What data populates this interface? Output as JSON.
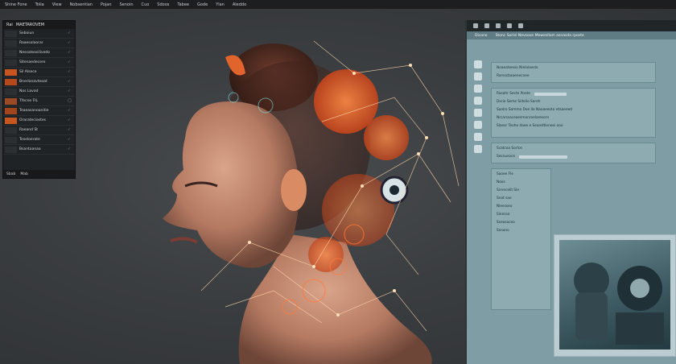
{
  "menubar": [
    "Shine Fone",
    "Tolia",
    "View",
    "Nobsentian",
    "Pojan",
    "Senoin",
    "Cuo",
    "Sdoos",
    "Tabee",
    "Gode",
    "Ylan",
    "Aleddo"
  ],
  "layers": {
    "header": [
      "Rai",
      "MAETAROVEM"
    ],
    "rows": [
      {
        "label": "Seboiun",
        "vis": "✓"
      },
      {
        "label": "Raaesolaorar",
        "vis": "✓"
      },
      {
        "label": "Nessateasilivedo",
        "vis": "✓"
      },
      {
        "label": "Sitenaedecere",
        "vis": "✓"
      },
      {
        "label": "Sil Alsece",
        "vis": "✓"
      },
      {
        "label": "Bnerlanavteoat",
        "vis": "✓"
      },
      {
        "label": "Nos Lavad",
        "vis": "✓"
      },
      {
        "label": "Tfecne FIL",
        "vis": "◯"
      },
      {
        "label": "Teaeasanoanitie",
        "vis": "✓"
      },
      {
        "label": "Orarateciastes",
        "vis": "✓"
      },
      {
        "label": "Raeand St",
        "vis": "✓"
      },
      {
        "label": "Teseloerate",
        "vis": "✓"
      },
      {
        "label": "Bsantaanaa",
        "vis": "✓"
      }
    ],
    "footer": [
      "Sbab",
      "Mab"
    ]
  },
  "right_panel": {
    "tabs": [
      "Dicono",
      "Stonc Sorlei Nevsoon Mewesllom asnasda rposte"
    ],
    "sections": [
      [
        "Noaeateesio Nlelalaeslo",
        "Rarsscbaaenecnee"
      ],
      [
        "Rasahr  Sectn Ponte",
        "Dxrie Seme  Sidelio Sareh",
        "Saalro Sommo Doe Ile Naoaeeoto etaaeeed",
        "Nrcarssaceaesmonroelaresorn",
        "Slaesr Teohe daee e Searettleneei ooo"
      ],
      [
        "Scatcoa Sorlce",
        "Secnusoce"
      ],
      [
        "Saoee Fle",
        "Noos",
        "Sirnecelit Sle",
        "Snot sae",
        "Nleesseo",
        "Siensso",
        "Sseosaceo",
        "Ssnano"
      ]
    ]
  },
  "colors": {
    "accent": "#e4473a",
    "panel": "#7f9da5",
    "canvas": "#3b3e41"
  }
}
